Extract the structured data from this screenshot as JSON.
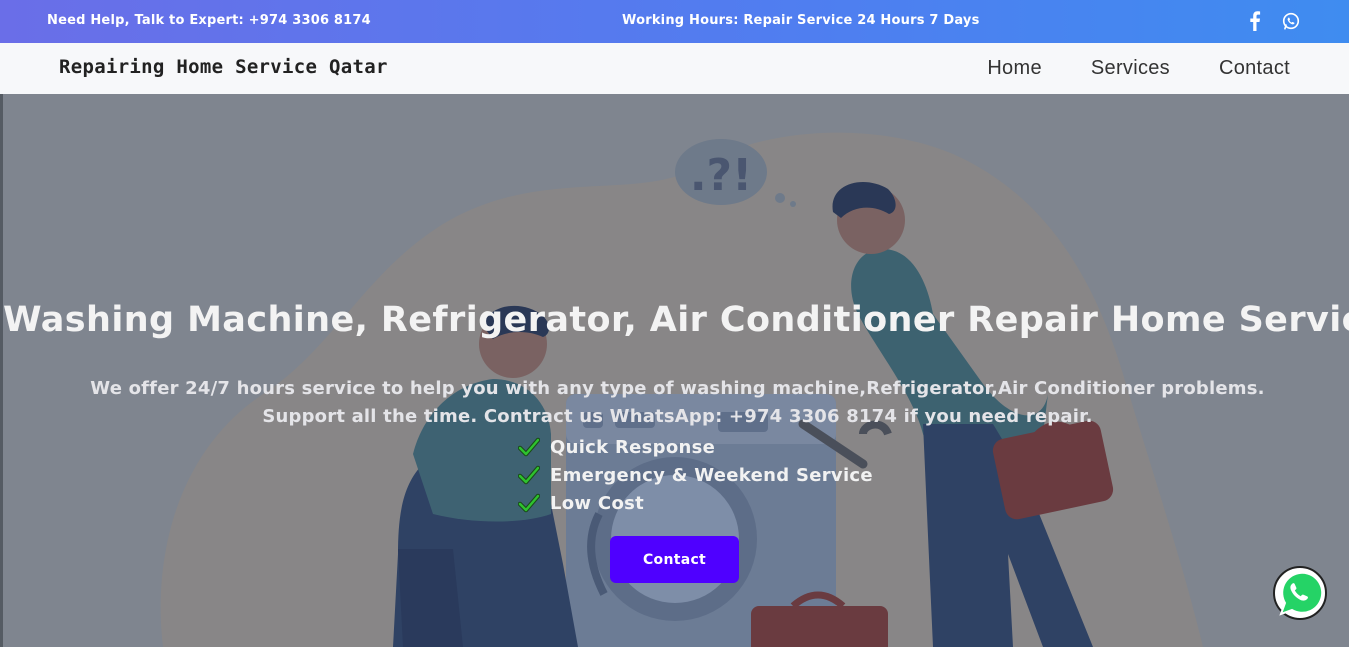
{
  "topbar": {
    "help_text": "Need Help, Talk to Expert: +974 3306 8174",
    "hours_text": "Working Hours: Repair Service 24 Hours 7 Days",
    "social": [
      "facebook-icon",
      "whatsapp-icon"
    ]
  },
  "navbar": {
    "brand": "Repairing Home Service Qatar",
    "links": [
      "Home",
      "Services",
      "Contact"
    ]
  },
  "hero": {
    "title": "Washing Machine, Refrigerator, Air Conditioner Repair Home Service",
    "description": "We offer 24/7 hours service to help you with any type of washing machine,Refrigerator,Air Conditioner problems. Support all the time. Contract us WhatsApp: +974 3306 8174 if you need repair.",
    "features": [
      "Quick Response",
      "Emergency & Weekend Service",
      "Low Cost"
    ],
    "cta_label": "Contact",
    "bubble_text": ".?!",
    "overlay_color": "#7f858f",
    "cta_color": "#4f00ff",
    "check_color": "#2ec22e"
  },
  "floating": {
    "icon": "whatsapp-icon",
    "color": "#25d366"
  }
}
